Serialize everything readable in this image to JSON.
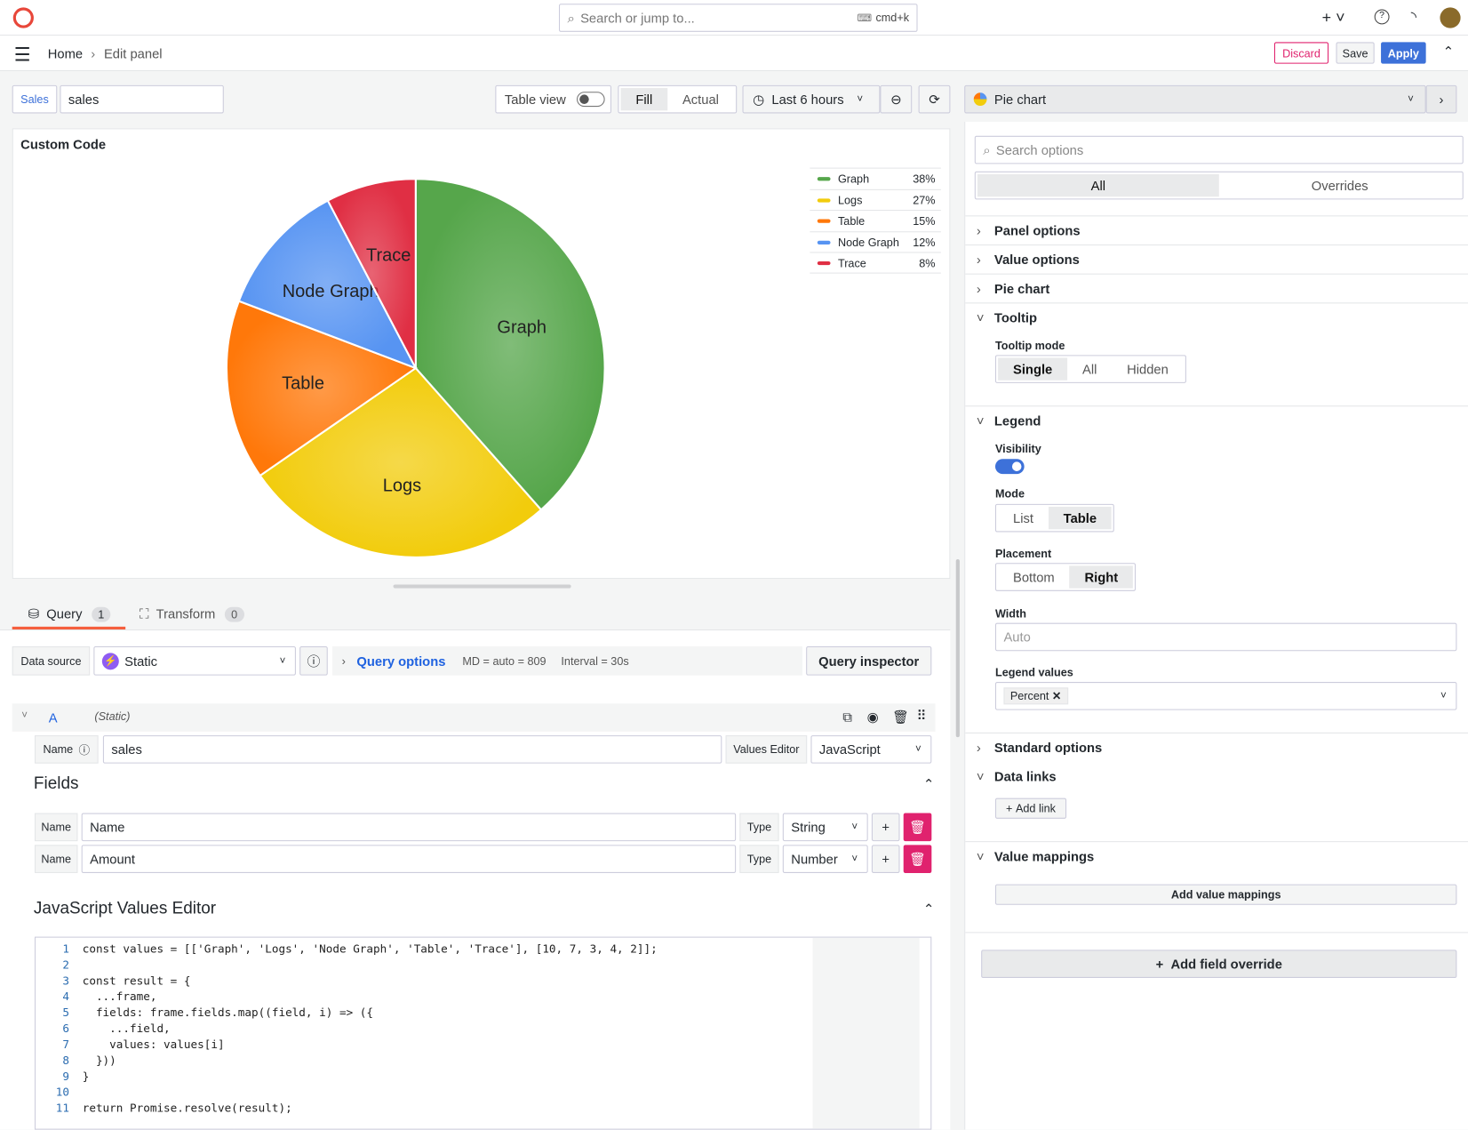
{
  "topbar": {
    "search_placeholder": "Search or jump to...",
    "shortcut": "cmd+k"
  },
  "nav": {
    "breadcrumb": [
      "Home",
      "Edit panel"
    ],
    "discard": "Discard",
    "save": "Save",
    "apply": "Apply"
  },
  "toolbar": {
    "ds_tag": "Sales",
    "panel_name": "sales",
    "table_view": "Table view",
    "fill": "Fill",
    "actual": "Actual",
    "time_range": "Last 6 hours",
    "viz": "Pie chart"
  },
  "panel": {
    "title": "Custom Code"
  },
  "chart_data": {
    "type": "pie",
    "title": "Custom Code",
    "slices": [
      {
        "label": "Graph",
        "value": 10,
        "percent": 38,
        "color": "#56a64b"
      },
      {
        "label": "Logs",
        "value": 7,
        "percent": 27,
        "color": "#f2cc0c"
      },
      {
        "label": "Table",
        "value": 4,
        "percent": 15,
        "color": "#ff780a"
      },
      {
        "label": "Node Graph",
        "value": 3,
        "percent": 12,
        "color": "#5794f2"
      },
      {
        "label": "Trace",
        "value": 2,
        "percent": 8,
        "color": "#e02f44"
      }
    ],
    "legend": {
      "placement": "right",
      "mode": "table",
      "values": [
        "Percent"
      ],
      "order": [
        "Graph",
        "Logs",
        "Table",
        "Node Graph",
        "Trace"
      ]
    }
  },
  "tabs": [
    {
      "label": "Query",
      "count": "1"
    },
    {
      "label": "Transform",
      "count": "0"
    }
  ],
  "query": {
    "ds_label": "Data source",
    "ds_value": "Static",
    "options_label": "Query options",
    "md": "MD = auto = 809",
    "interval": "Interval = 30s",
    "inspector": "Query inspector",
    "refid": "A",
    "ds_hint": "(Static)",
    "name_label": "Name",
    "name_value": "sales",
    "ve_label": "Values Editor",
    "ve_value": "JavaScript",
    "fields_title": "Fields",
    "fields": [
      {
        "label": "Name",
        "value": "Name",
        "type_label": "Type",
        "type": "String"
      },
      {
        "label": "Name",
        "value": "Amount",
        "type_label": "Type",
        "type": "Number"
      }
    ],
    "js_title": "JavaScript Values Editor",
    "code": [
      "const values = [['Graph', 'Logs', 'Node Graph', 'Table', 'Trace'], [10, 7, 3, 4, 2]];",
      "",
      "const result = {",
      "  ...frame,",
      "  fields: frame.fields.map((field, i) => ({",
      "    ...field,",
      "    values: values[i]",
      "  }))",
      "}",
      "",
      "return Promise.resolve(result);"
    ]
  },
  "options": {
    "search_placeholder": "Search options",
    "tab_all": "All",
    "tab_overrides": "Overrides",
    "panel_options": "Panel options",
    "value_options": "Value options",
    "pie_chart": "Pie chart",
    "tooltip": "Tooltip",
    "tooltip_mode": "Tooltip mode",
    "tooltip_modes": [
      "Single",
      "All",
      "Hidden"
    ],
    "legend": "Legend",
    "visibility": "Visibility",
    "mode": "Mode",
    "modes": [
      "List",
      "Table"
    ],
    "placement": "Placement",
    "placements": [
      "Bottom",
      "Right"
    ],
    "width": "Width",
    "width_placeholder": "Auto",
    "legend_values": "Legend values",
    "legend_value_tag": "Percent",
    "standard_options": "Standard options",
    "data_links": "Data links",
    "add_link": "Add link",
    "value_mappings": "Value mappings",
    "add_value_mappings": "Add value mappings",
    "add_field_override": "Add field override"
  },
  "colors": {
    "accent": "#3d71d9",
    "danger": "#e0226e",
    "tab_underline": "#f55f3e"
  }
}
